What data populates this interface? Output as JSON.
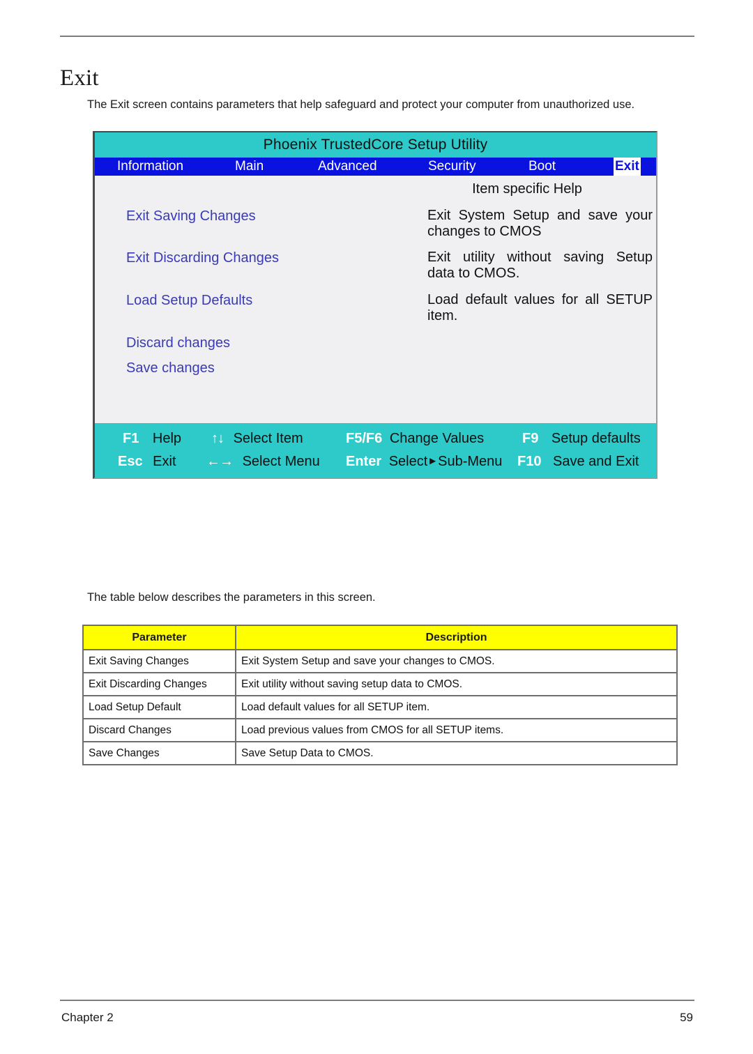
{
  "document": {
    "heading": "Exit",
    "intro": "The Exit screen contains parameters that help safeguard and protect your computer from unauthorized use.",
    "table_intro": "The table below describes the parameters in this screen.",
    "footer_left": "Chapter 2",
    "footer_right": "59"
  },
  "bios": {
    "title": "Phoenix TrustedCore Setup Utility",
    "menubar": {
      "tabs": [
        {
          "label": "Information",
          "active": false
        },
        {
          "label": "Main",
          "active": false
        },
        {
          "label": "Advanced",
          "active": false
        },
        {
          "label": "Security",
          "active": false
        },
        {
          "label": "Boot",
          "active": false
        },
        {
          "label": "Exit",
          "active": true
        }
      ]
    },
    "help_panel_title": "Item specific Help",
    "menu_items": [
      {
        "label": "Exit Saving Changes"
      },
      {
        "label": "Exit Discarding Changes"
      },
      {
        "label": "Load Setup Defaults"
      },
      {
        "label": "Discard changes"
      },
      {
        "label": "Save changes"
      }
    ],
    "help_texts": [
      {
        "line1": "Exit System Setup and save your",
        "line2": "changes to CMOS"
      },
      {
        "line1": "Exit utility without saving Setup",
        "line2": "data to CMOS."
      },
      {
        "line1": "Load default values for all SETUP",
        "line2": "item."
      }
    ],
    "function_keys": [
      {
        "key": "F1",
        "desc": "Help"
      },
      {
        "key": "↑↓",
        "desc": "Select Item"
      },
      {
        "key": "F5/F6",
        "desc": "Change Values"
      },
      {
        "key": "F9",
        "desc": "Setup defaults"
      },
      {
        "key": "Esc",
        "desc": "Exit"
      },
      {
        "key": "←→",
        "desc": "Select Menu"
      },
      {
        "key": "Enter",
        "desc_pre": "Select",
        "desc_post": "Sub-Menu"
      },
      {
        "key": "F10",
        "desc": "Save and Exit"
      }
    ],
    "colors": {
      "title_bar": "#2ec9c9",
      "menu_bar": "#0a12e0",
      "body": "#f0f0f2",
      "menu_item_text": "#3a3ab4",
      "footer_bar": "#2ec9c9"
    }
  },
  "param_table": {
    "headers": [
      "Parameter",
      "Description"
    ],
    "rows": [
      [
        "Exit Saving Changes",
        "Exit System Setup and save your changes to CMOS."
      ],
      [
        "Exit Discarding Changes",
        "Exit utility without saving setup data to CMOS."
      ],
      [
        "Load Setup Default",
        "Load default values for all SETUP item."
      ],
      [
        "Discard Changes",
        "Load previous values from CMOS for all SETUP items."
      ],
      [
        "Save Changes",
        "Save Setup Data to CMOS."
      ]
    ],
    "header_bg": "#ffff00"
  }
}
